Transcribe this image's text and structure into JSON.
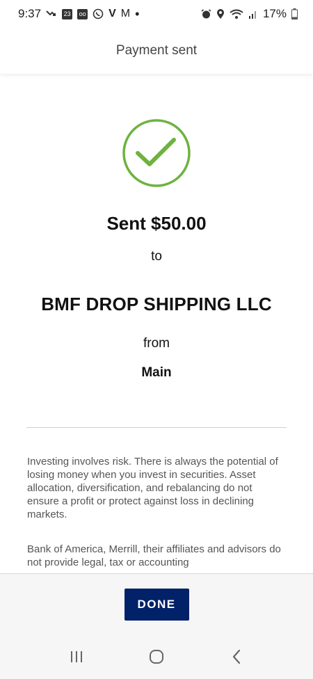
{
  "status_bar": {
    "time": "9:37",
    "battery": "17%",
    "box_icon_1": "23",
    "box_icon_2": "oo",
    "v_letter": "V",
    "m_letter": "M",
    "dot": "•"
  },
  "header": {
    "title": "Payment sent"
  },
  "confirmation": {
    "amount_text": "Sent $50.00",
    "to_text": "to",
    "recipient": "BMF DROP SHIPPING LLC",
    "from_text": "from",
    "account": "Main"
  },
  "disclaimers": [
    "Investing involves risk. There is always the potential of losing money when you invest in securities. Asset allocation, diversification, and rebalancing do not ensure a profit or protect against loss in declining markets.",
    "Bank of America, Merrill, their affiliates and advisors do not provide legal, tax or accounting"
  ],
  "actions": {
    "done_label": "DONE"
  },
  "colors": {
    "success_green": "#6db33f",
    "button_navy": "#012169",
    "text_dark": "#111111",
    "text_muted": "#555555"
  },
  "icons": {
    "check": "check-circle-icon",
    "nav_recents": "recents-icon",
    "nav_home": "home-icon",
    "nav_back": "back-icon"
  }
}
